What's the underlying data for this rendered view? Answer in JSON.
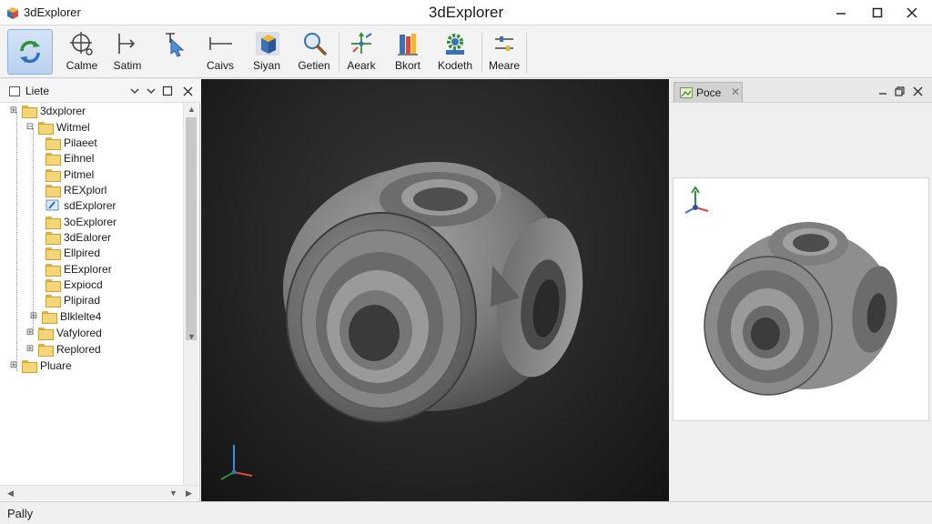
{
  "titlebar": {
    "app_name": "3dExplorer",
    "title": "3dExplorer"
  },
  "toolbar": {
    "tools": [
      {
        "label": "",
        "icon": "rotate-icon"
      },
      {
        "label": "Calme",
        "icon": "crosshair-icon"
      },
      {
        "label": "Satim",
        "icon": "cursor-select-icon"
      },
      {
        "label": "Caivs",
        "icon": "measure-icon"
      },
      {
        "label": "Siyan",
        "icon": "cube-icon"
      },
      {
        "label": "Getien",
        "icon": "magnifier-icon"
      },
      {
        "label": "Aeark",
        "icon": "arrows-icon"
      },
      {
        "label": "Bkort",
        "icon": "books-icon"
      },
      {
        "label": "Kodeth",
        "icon": "gear-icon"
      },
      {
        "label": "Meare",
        "icon": "sliders-icon"
      }
    ]
  },
  "left_panel": {
    "title": "Liete",
    "tree": [
      {
        "label": "3dxplorer",
        "toggle": "⊞"
      },
      {
        "label": "Witmel",
        "toggle": "⊟"
      },
      {
        "label": "Pilaeet",
        "toggle": ""
      },
      {
        "label": "Eihnel",
        "toggle": ""
      },
      {
        "label": "Pitmel",
        "toggle": ""
      },
      {
        "label": "REXplorl",
        "toggle": ""
      },
      {
        "label": "sdExplorer",
        "toggle": ""
      },
      {
        "label": "3oExplorer",
        "toggle": ""
      },
      {
        "label": "3dEalorer",
        "toggle": ""
      },
      {
        "label": "Ellpired",
        "toggle": ""
      },
      {
        "label": "EExplorer",
        "toggle": ""
      },
      {
        "label": "Expiocd",
        "toggle": ""
      },
      {
        "label": "Plipirad",
        "toggle": ""
      },
      {
        "label": "Blklelte4",
        "toggle": "⊞"
      },
      {
        "label": "Vafylored",
        "toggle": "⊞"
      },
      {
        "label": "Replored",
        "toggle": "⊞"
      },
      {
        "label": "Pluare",
        "toggle": "⊞"
      }
    ]
  },
  "right_panel": {
    "tab_label": "Poce"
  },
  "status": {
    "text": "Pally"
  },
  "colors": {
    "accent": "#b9d1ee",
    "viewport_bg": "#262626",
    "model": "#8a8a8a",
    "folder": "#f4d67a"
  }
}
